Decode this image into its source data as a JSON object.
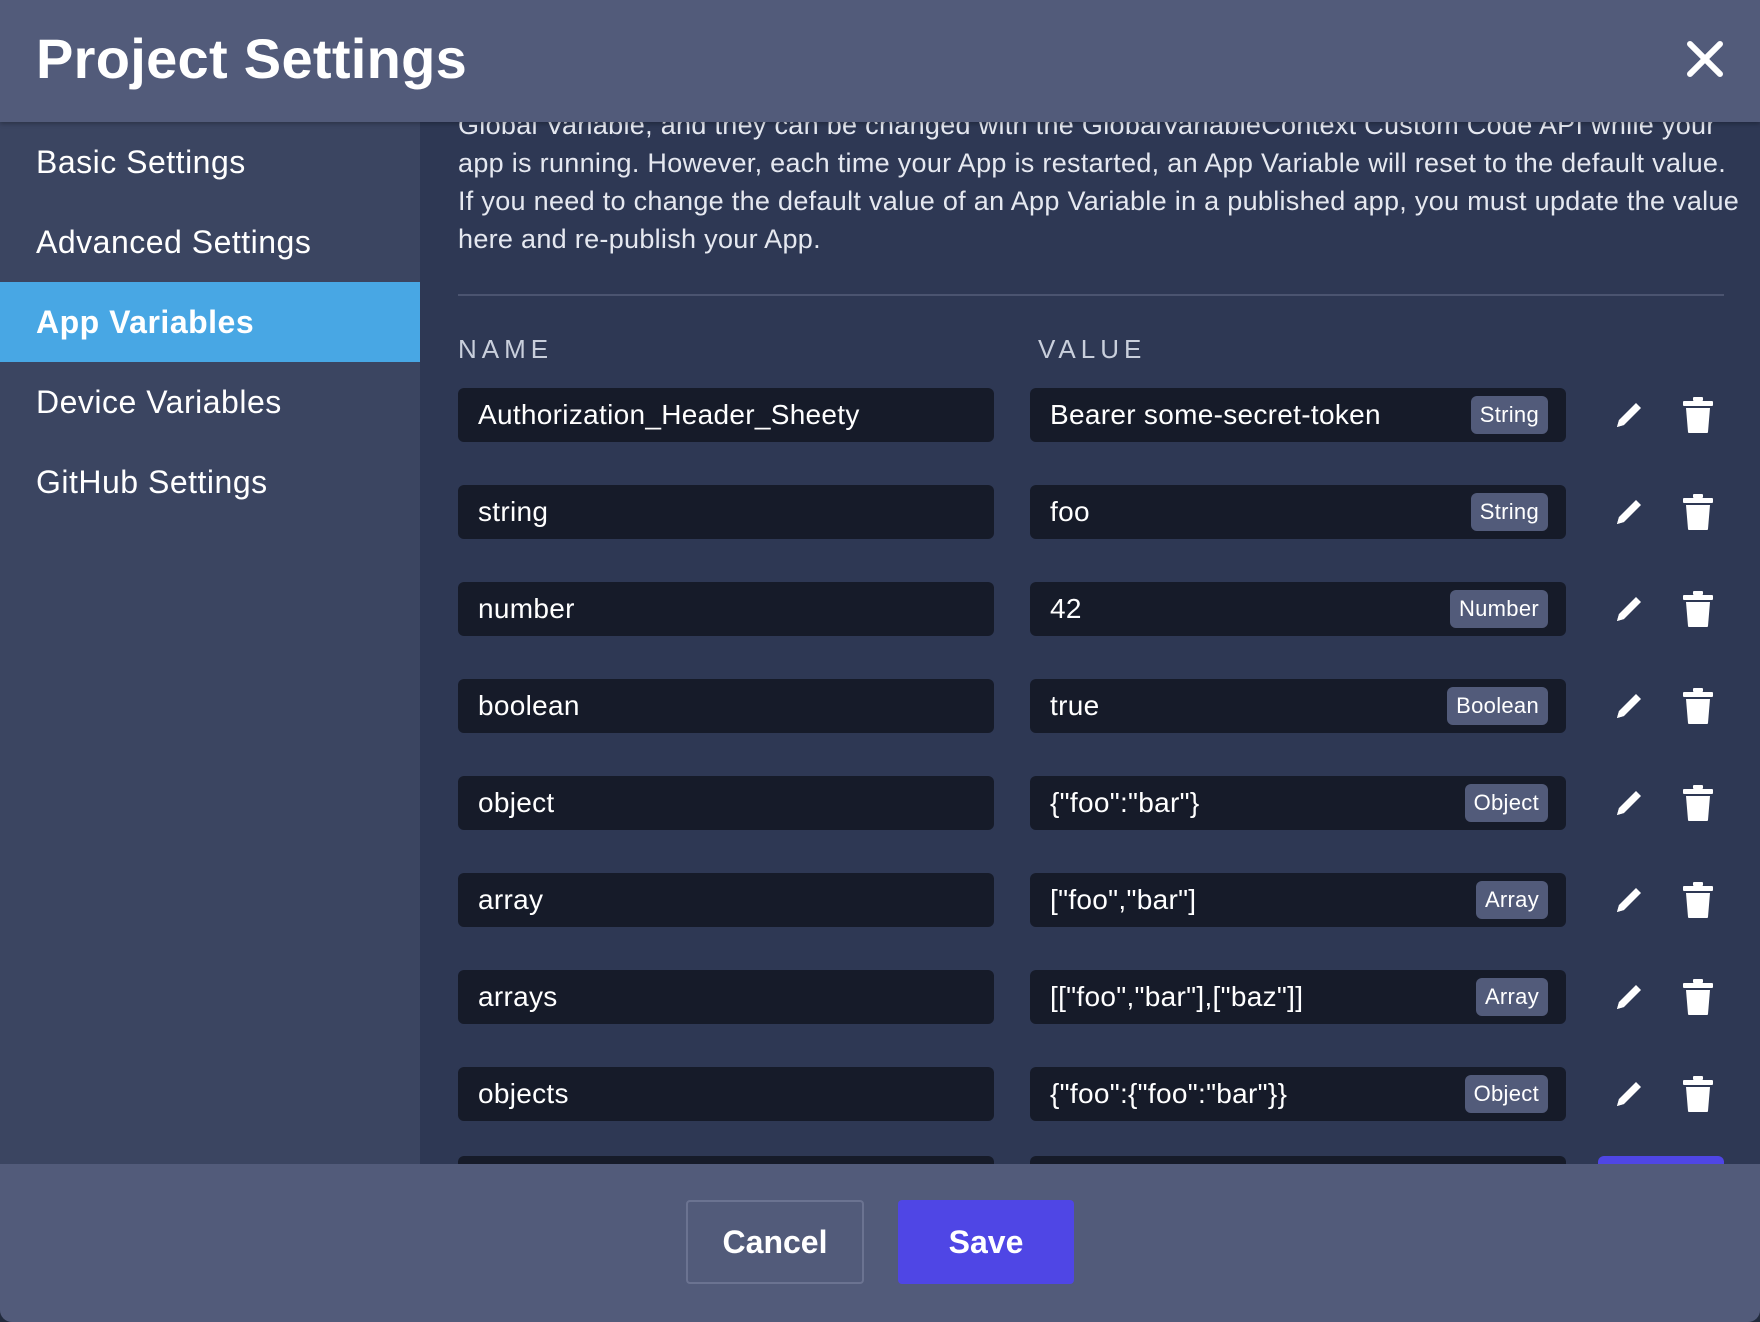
{
  "dialog": {
    "title": "Project Settings"
  },
  "sidebar": {
    "items": [
      {
        "label": "Basic Settings",
        "active": false
      },
      {
        "label": "Advanced Settings",
        "active": false
      },
      {
        "label": "App Variables",
        "active": true
      },
      {
        "label": "Device Variables",
        "active": false
      },
      {
        "label": "GitHub Settings",
        "active": false
      }
    ]
  },
  "main": {
    "description": "Global Variable, and they can be changed with the GlobalVariableContext Custom Code API while your app is running. However, each time your App is restarted, an App Variable will reset to the default value. If you need to change the default value of an App Variable in a published app, you must update the value here and re-publish your App.",
    "columns": {
      "name": "NAME",
      "value": "VALUE"
    },
    "variables": [
      {
        "name": "Authorization_Header_Sheety",
        "value": "Bearer some-secret-token",
        "type": "String"
      },
      {
        "name": "string",
        "value": "foo",
        "type": "String"
      },
      {
        "name": "number",
        "value": "42",
        "type": "Number"
      },
      {
        "name": "boolean",
        "value": "true",
        "type": "Boolean"
      },
      {
        "name": "object",
        "value": "{\"foo\":\"bar\"}",
        "type": "Object"
      },
      {
        "name": "array",
        "value": "[\"foo\",\"bar\"]",
        "type": "Array"
      },
      {
        "name": "arrays",
        "value": "[[\"foo\",\"bar\"],[\"baz\"]]",
        "type": "Array"
      },
      {
        "name": "objects",
        "value": "{\"foo\":{\"foo\":\"bar\"}}",
        "type": "Object"
      }
    ]
  },
  "footer": {
    "cancel_label": "Cancel",
    "save_label": "Save"
  },
  "colors": {
    "header_bg": "#525b7a",
    "sidebar_active": "#48a7e4",
    "content_bg": "#2e3854",
    "field_bg": "#161b29",
    "save_button": "#4f46e5"
  },
  "icons": {
    "close": "close-icon",
    "edit": "pencil-icon",
    "delete": "trash-icon"
  }
}
